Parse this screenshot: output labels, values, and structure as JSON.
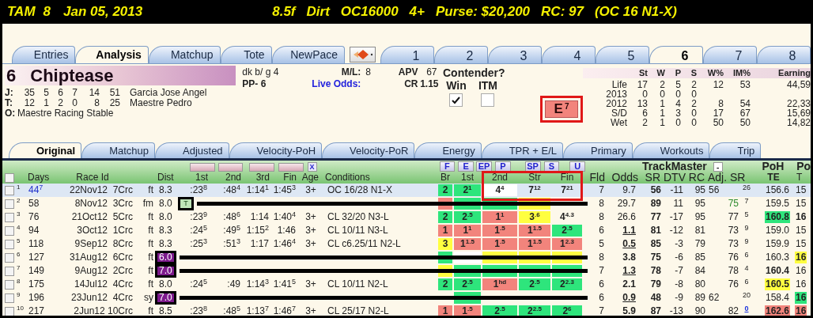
{
  "title_bar": {
    "race": [
      "TAM",
      "8",
      "Jan 05, 2013"
    ],
    "conditions": [
      "8.5f",
      "Dirt",
      "OC16000",
      "4+",
      "Purse: $20,200",
      "RC: 97",
      "(OC 16 N1-X)"
    ]
  },
  "main_tabs": [
    {
      "label": "Entries",
      "selected": false
    },
    {
      "label": "Analysis",
      "selected": true
    },
    {
      "label": "Matchup",
      "selected": false
    },
    {
      "label": "Tote",
      "selected": false
    },
    {
      "label": "NewPace",
      "selected": false
    }
  ],
  "horse_tabs": [
    {
      "label": "1",
      "selected": false
    },
    {
      "label": "2",
      "selected": false
    },
    {
      "label": "3",
      "selected": false
    },
    {
      "label": "4",
      "selected": false
    },
    {
      "label": "5",
      "selected": false
    },
    {
      "label": "6",
      "selected": true
    },
    {
      "label": "7",
      "selected": false
    },
    {
      "label": "8",
      "selected": false
    }
  ],
  "horse": {
    "number": "6",
    "name": "Chiptease",
    "description": "dk b/ g 4",
    "post": "PP- 6",
    "ml_label": "M/L:",
    "ml": "8",
    "live_odds": "Live Odds:",
    "apv_label": "APV",
    "apv": "67",
    "cr_label": "CR",
    "cr": "1.15",
    "connections": [
      {
        "label": "J:",
        "stats": [
          "35",
          "5",
          "6",
          "7",
          "14",
          "51"
        ],
        "name": "Garcia Jose Angel"
      },
      {
        "label": "T:",
        "stats": [
          "12",
          "1",
          "2",
          "0",
          "8",
          "25"
        ],
        "name": "Maestre Pedro"
      }
    ],
    "owner_label": "O:",
    "owner": "Maestre Racing Stable"
  },
  "contender": {
    "title": "Contender?",
    "options": [
      {
        "label": "Win",
        "checked": true
      },
      {
        "label": "ITM",
        "checked": false
      }
    ]
  },
  "energy_button": {
    "text": "E",
    "sup": "7"
  },
  "record": {
    "columns": [
      "",
      "St",
      "W",
      "P",
      "S",
      "W%",
      "IM%",
      "Earning"
    ],
    "rows": [
      [
        "Life",
        "17",
        "2",
        "5",
        "2",
        "12",
        "53",
        "44,59"
      ],
      [
        "2013",
        "0",
        "0",
        "0",
        "0"
      ],
      [
        "2012",
        "13",
        "1",
        "4",
        "2",
        "8",
        "54",
        "22,33"
      ],
      [
        "S/D",
        "6",
        "1",
        "3",
        "0",
        "17",
        "67",
        "15,69"
      ],
      [
        "Wet",
        "2",
        "1",
        "0",
        "0",
        "50",
        "50",
        "14,82"
      ]
    ]
  },
  "sub_tabs": [
    {
      "label": "Original",
      "selected": true
    },
    {
      "label": "Matchup",
      "selected": false
    },
    {
      "label": "Adjusted",
      "selected": false
    },
    {
      "label": "Velocity-PoH",
      "selected": false
    },
    {
      "label": "Velocity-PoR",
      "selected": false
    },
    {
      "label": "Energy",
      "selected": false
    },
    {
      "label": "TPR + E/L",
      "selected": false
    },
    {
      "label": "Primary",
      "selected": false
    },
    {
      "label": "Workouts",
      "selected": false
    },
    {
      "label": "Trip",
      "selected": false
    }
  ],
  "table": {
    "select_all": {
      "checked": false
    },
    "x_button": "X",
    "pace_buttons": [
      "F",
      "E",
      "EP",
      "P",
      "SP",
      "S",
      "U"
    ],
    "group_label": "TrackMaster",
    "collapse_button": "-",
    "te_group": "PoH",
    "last_group": "Po",
    "columns": [
      "Days",
      "Race Id",
      "Dist",
      "1st",
      "2nd",
      "3rd",
      "Fin",
      "Age",
      "Conditions",
      "Br",
      "1st",
      "2nd",
      "Str",
      "Fin",
      "Fld",
      "Odds",
      "SR",
      "DTV",
      "RC",
      "Adj. SR",
      "TE",
      "T"
    ],
    "rows": [
      {
        "selected": true,
        "checked": false,
        "struck": false,
        "num": "1",
        "days": {
          "text": "44$^{7}$",
          "color": "#2233cc"
        },
        "race": "22Nov12  7Crc",
        "surf": "ft",
        "dist": "8.3",
        "t1": ":23$^{8}$",
        "t2": ":48$^{4}$",
        "t3": "1:14$^{1}$",
        "t4": "1:45$^{3}$",
        "age": "3+",
        "cond": "OC 16/28 N1-X",
        "br": {
          "text": "2",
          "color": "#2ee57c"
        },
        "c1": {
          "text": "2$^{1}$",
          "color": "#2ee57c"
        },
        "c2": {
          "text": "4$^{4}$",
          "color": "#ffffff"
        },
        "c3": {
          "text": "7$^{12}$"
        },
        "c4": {
          "text": "7$^{21}$"
        },
        "fld": "7",
        "odds": {
          "text": "9.7"
        },
        "sr": "56",
        "dtv": "-11",
        "rc": "95",
        "adj": "56",
        "rank": "26",
        "te": {
          "text": "156.6"
        },
        "t": {
          "text": "15"
        }
      },
      {
        "selected": false,
        "checked": false,
        "struck": true,
        "num": "2",
        "days": {
          "text": "58"
        },
        "race": "8Nov12  3Crc",
        "surf": "fm",
        "dist": "8.0",
        "note": "T",
        "br": {
          "color": "#f2847c"
        },
        "c1": {
          "color": "#2ee57c"
        },
        "c2": {
          "color": "#2ee57c"
        },
        "c3": {
          "color": "#ffff40"
        },
        "fld": "8",
        "odds": {
          "text": "29.7"
        },
        "sr": "89",
        "dtv": "11",
        "rc": "95",
        "sr2": {
          "text": "75",
          "color": "#2e8b2e"
        },
        "rank": "7",
        "te": {
          "text": "159.5"
        },
        "t": {
          "text": "15"
        }
      },
      {
        "selected": false,
        "checked": false,
        "struck": false,
        "num": "3",
        "days": {
          "text": "76"
        },
        "race": "21Oct12  5Crc",
        "surf": "ft",
        "dist": "8.0",
        "t1": ":23$^{9}$",
        "t2": ":48$^{6}$",
        "t3": "1:14",
        "t4": "1:40$^{4}$",
        "age": "3+",
        "cond": "CL 32/20 N3-L",
        "br": {
          "text": "2",
          "color": "#2ee57c"
        },
        "c1": {
          "text": "2$^{.5}$",
          "color": "#2ee57c"
        },
        "c2": {
          "text": "1$^{1}$",
          "color": "#f2847c"
        },
        "c3": {
          "text": "3$^{.6}$",
          "color": "#ffff40"
        },
        "c4": {
          "text": "4$^{4.3}$"
        },
        "fld": "8",
        "odds": {
          "text": "26.6"
        },
        "sr": "77",
        "dtv": "-17",
        "rc": "95",
        "sr2": {
          "text": "77"
        },
        "rank": "5",
        "te": {
          "text": "160.8",
          "color": "#2ee57c",
          "bold": true
        },
        "t": {
          "text": "16",
          "bold": true
        }
      },
      {
        "selected": false,
        "checked": false,
        "struck": false,
        "num": "4",
        "days": {
          "text": "94"
        },
        "race": "3Oct12  1Crc",
        "surf": "ft",
        "dist": "8.3",
        "t1": ":24$^{5}$",
        "t2": ":49$^{5}$",
        "t3": "1:15$^{2}$",
        "t4": "1:46",
        "age": "3+",
        "cond": "CL 10/11 N3-L",
        "br": {
          "text": "1",
          "color": "#f2847c"
        },
        "c1": {
          "text": "1$^{1}$",
          "color": "#f2847c"
        },
        "c2": {
          "text": "1$^{.5}$",
          "color": "#f2847c"
        },
        "c3": {
          "text": "1$^{1.5}$",
          "color": "#f2847c"
        },
        "c4": {
          "text": "2$^{.5}$",
          "color": "#2ee57c"
        },
        "fld": "6",
        "odds": {
          "text": "1.1",
          "bold": true,
          "underline": true
        },
        "sr": "81",
        "dtv": "-12",
        "rc": "81",
        "sr2": {
          "text": "73"
        },
        "rank": "9",
        "te": {
          "text": "159.0"
        },
        "t": {
          "text": "15"
        }
      },
      {
        "selected": false,
        "checked": false,
        "struck": false,
        "num": "5",
        "days": {
          "text": "118"
        },
        "race": "9Sep12  8Crc",
        "surf": "ft",
        "dist": "8.3",
        "t1": ":25$^{3}$",
        "t2": ":51$^{3}$",
        "t3": "1:17",
        "t4": "1:46$^{4}$",
        "age": "3+",
        "cond": "CL c6.25/11 N2-L",
        "br": {
          "text": "3",
          "color": "#ffff40"
        },
        "c1": {
          "text": "1$^{1.5}$",
          "color": "#f2847c"
        },
        "c2": {
          "text": "1$^{.5}$",
          "color": "#f2847c"
        },
        "c3": {
          "text": "1$^{1.5}$",
          "color": "#f2847c"
        },
        "c4": {
          "text": "1$^{2.3}$",
          "color": "#f2847c"
        },
        "fld": "5",
        "odds": {
          "text": "0.5",
          "bold": true,
          "underline": true
        },
        "sr": "85",
        "dtv": "-3",
        "rc": "79",
        "sr2": {
          "text": "73"
        },
        "rank": "9",
        "te": {
          "text": "159.9"
        },
        "t": {
          "text": "15"
        }
      },
      {
        "selected": false,
        "checked": false,
        "struck": true,
        "num": "6",
        "days": {
          "text": "127"
        },
        "race": "31Aug12  6Crc",
        "surf": "ft",
        "dist": {
          "text": "6.0",
          "color": "#7d1a8c",
          "boxed": true
        },
        "br": {
          "color": "#2ee57c"
        },
        "c1": {
          "color": "#ffffff"
        },
        "c2": {
          "color": "#ffff40"
        },
        "c3": {
          "color": "#ffff40"
        },
        "c4": {
          "color": "#ffff40"
        },
        "fld": "8",
        "odds": {
          "text": "3.8",
          "bold": true
        },
        "sr": "75",
        "dtv": "-6",
        "rc": "85",
        "sr2": {
          "text": "76"
        },
        "rank": "6",
        "te": {
          "text": "160.3"
        },
        "t": {
          "text": "16",
          "color": "#ffff40",
          "bold": true
        }
      },
      {
        "selected": false,
        "checked": false,
        "struck": true,
        "num": "7",
        "days": {
          "text": "149"
        },
        "race": "9Aug12  2Crc",
        "surf": "ft",
        "dist": {
          "text": "7.0",
          "color": "#7d1a8c",
          "boxed": true
        },
        "br": {
          "color": "#ffff40"
        },
        "c1": {
          "color": "#2ee57c"
        },
        "c2": {
          "color": "#2ee57c"
        },
        "c3": {
          "color": "#2ee57c"
        },
        "c4": {
          "color": "#2ee57c"
        },
        "fld": "7",
        "odds": {
          "text": "1.3",
          "bold": true,
          "underline": true
        },
        "sr": "78",
        "dtv": "-7",
        "rc": "84",
        "sr2": {
          "text": "78"
        },
        "rank": "4",
        "te": {
          "text": "160.4",
          "bold": true
        },
        "t": {
          "text": "16"
        }
      },
      {
        "selected": false,
        "checked": false,
        "struck": false,
        "num": "8",
        "days": {
          "text": "175"
        },
        "race": "14Jul12  4Crc",
        "surf": "ft",
        "dist": "8.0",
        "t1": ":24$^{5}$",
        "t2": ":49",
        "t3": "1:14$^{3}$",
        "t4": "1:41$^{5}$",
        "age": "3+",
        "cond": "CL 10/11 N2-L",
        "br": {
          "text": "2",
          "color": "#2ee57c"
        },
        "c1": {
          "text": "2$^{.5}$",
          "color": "#2ee57c"
        },
        "c2": {
          "text": "1$^{hd}$",
          "color": "#f2847c"
        },
        "c3": {
          "text": "2$^{.5}$",
          "color": "#2ee57c"
        },
        "c4": {
          "text": "2$^{2.3}$",
          "color": "#2ee57c"
        },
        "fld": "6",
        "odds": {
          "text": "2.1",
          "bold": true
        },
        "sr": "79",
        "dtv": "-8",
        "rc": "80",
        "sr2": {
          "text": "76"
        },
        "rank": "6",
        "te": {
          "text": "160.5",
          "color": "#ffff40",
          "bold": true
        },
        "t": {
          "text": "16"
        }
      },
      {
        "selected": false,
        "checked": false,
        "struck": true,
        "num": "9",
        "days": {
          "text": "196"
        },
        "race": "23Jun12  4Crc",
        "surf": "sy",
        "dist": {
          "text": "7.0",
          "color": "#7d1a8c",
          "boxed": true
        },
        "c1": {
          "color": "#2ee57c"
        },
        "fld": "6",
        "odds": {
          "text": "0.9",
          "bold": true,
          "underline": true
        },
        "sr": "48",
        "dtv": "-9",
        "rc": "89",
        "adj": "62",
        "rank": "20",
        "te": {
          "text": "158.4"
        },
        "t": {
          "text": "16",
          "color": "#2ee57c",
          "bold": true
        }
      },
      {
        "selected": false,
        "checked": false,
        "struck": false,
        "num": "10",
        "days": {
          "text": "217"
        },
        "race": "2Jun12 10Crc",
        "surf": "ft",
        "dist": "8.5",
        "t1": ":23$^{8}$",
        "t2": ":48$^{5}$",
        "t3": "1:13$^{7}$",
        "t4": "1:46$^{7}$",
        "age": "3+",
        "cond": "CL 25/17 N2-L",
        "br": {
          "text": "1",
          "color": "#f2847c"
        },
        "c1": {
          "text": "1$^{.5}$",
          "color": "#f2847c"
        },
        "c2": {
          "text": "2$^{.5}$",
          "color": "#2ee57c"
        },
        "c3": {
          "text": "2$^{2.5}$",
          "color": "#2ee57c"
        },
        "c4": {
          "text": "2$^{6}$",
          "color": "#2ee57c"
        },
        "fld": "7",
        "odds": {
          "text": "5.9",
          "bold": true
        },
        "sr": "87",
        "dtv": "-13",
        "rc": "90",
        "sr2": {
          "text": "82"
        },
        "rank": {
          "text": "0",
          "color": "#1a33dd",
          "underline": true
        },
        "te": {
          "text": "162.6",
          "color": "#f2847c",
          "bold": true
        },
        "t": {
          "text": "16",
          "color": "#f2847c",
          "bold": true
        }
      }
    ]
  }
}
